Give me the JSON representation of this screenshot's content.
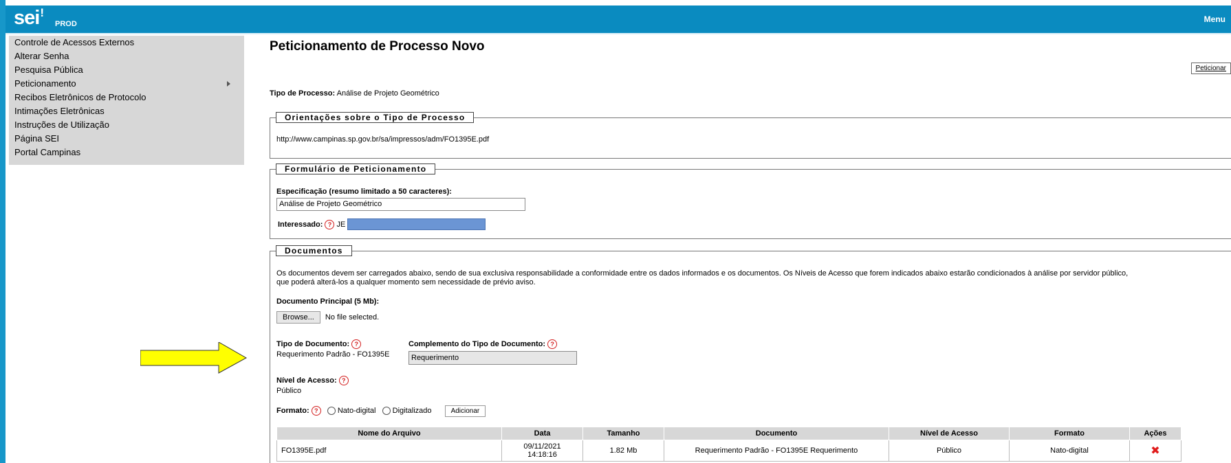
{
  "header": {
    "logo": "sei",
    "logo_suffix": "!",
    "environment": "PROD",
    "menu_label": "Menu"
  },
  "sidebar": {
    "items": [
      {
        "label": "Controle de Acessos Externos"
      },
      {
        "label": "Alterar Senha"
      },
      {
        "label": "Pesquisa Pública"
      },
      {
        "label": "Peticionamento",
        "has_submenu": true
      },
      {
        "label": "Recibos Eletrônicos de Protocolo"
      },
      {
        "label": "Intimações Eletrônicas"
      },
      {
        "label": "Instruções de Utilização"
      },
      {
        "label": "Página SEI"
      },
      {
        "label": "Portal Campinas"
      }
    ]
  },
  "main": {
    "title": "Peticionamento de Processo Novo",
    "peticionar_button": "Peticionar",
    "tipo_processo_label": "Tipo de Processo:",
    "tipo_processo_value": "Análise de Projeto Geométrico",
    "orientacoes": {
      "legend": "Orientações sobre o Tipo de Processo",
      "url": "http://www.campinas.sp.gov.br/sa/impressos/adm/FO1395E.pdf"
    },
    "formulario": {
      "legend": "Formulário de Peticionamento",
      "especificacao_label": "Especificação (resumo limitado a 50 caracteres):",
      "especificacao_value": "Análise de Projeto Geométrico",
      "interessado_label": "Interessado:",
      "interessado_value": "JE"
    },
    "documentos": {
      "legend": "Documentos",
      "info_line1": "Os documentos devem ser carregados abaixo, sendo de sua exclusiva responsabilidade a conformidade entre os dados informados e os documentos. Os Níveis de Acesso que forem indicados abaixo estarão condicionados à análise por servidor público,",
      "info_line2": "que poderá alterá-los a qualquer momento sem necessidade de prévio aviso.",
      "doc_principal_label": "Documento Principal (5 Mb):",
      "browse_label": "Browse...",
      "no_file_label": "No file selected.",
      "tipo_documento_label": "Tipo de Documento:",
      "tipo_documento_value": "Requerimento Padrão - FO1395E",
      "complemento_label": "Complemento do Tipo de Documento:",
      "complemento_value": "Requerimento",
      "nivel_acesso_label": "Nível de Acesso:",
      "nivel_acesso_value": "Público",
      "formato_label": "Formato:",
      "formato_options": [
        "Nato-digital",
        "Digitalizado"
      ],
      "adicionar_label": "Adicionar",
      "table": {
        "headers": [
          "Nome do Arquivo",
          "Data",
          "Tamanho",
          "Documento",
          "Nível de Acesso",
          "Formato",
          "Ações"
        ],
        "rows": [
          {
            "nome": "FO1395E.pdf",
            "data_date": "09/11/2021",
            "data_time": "14:18:16",
            "tamanho": "1.82 Mb",
            "documento": "Requerimento Padrão - FO1395E Requerimento",
            "nivel": "Público",
            "formato": "Nato-digital",
            "acao_icon": "remove-icon"
          }
        ]
      }
    }
  },
  "colors": {
    "header_bg": "#0a8bc0",
    "sidebar_bg": "#d7d7d7",
    "help_icon": "#d31f1f",
    "arrow": "#ffff00"
  }
}
